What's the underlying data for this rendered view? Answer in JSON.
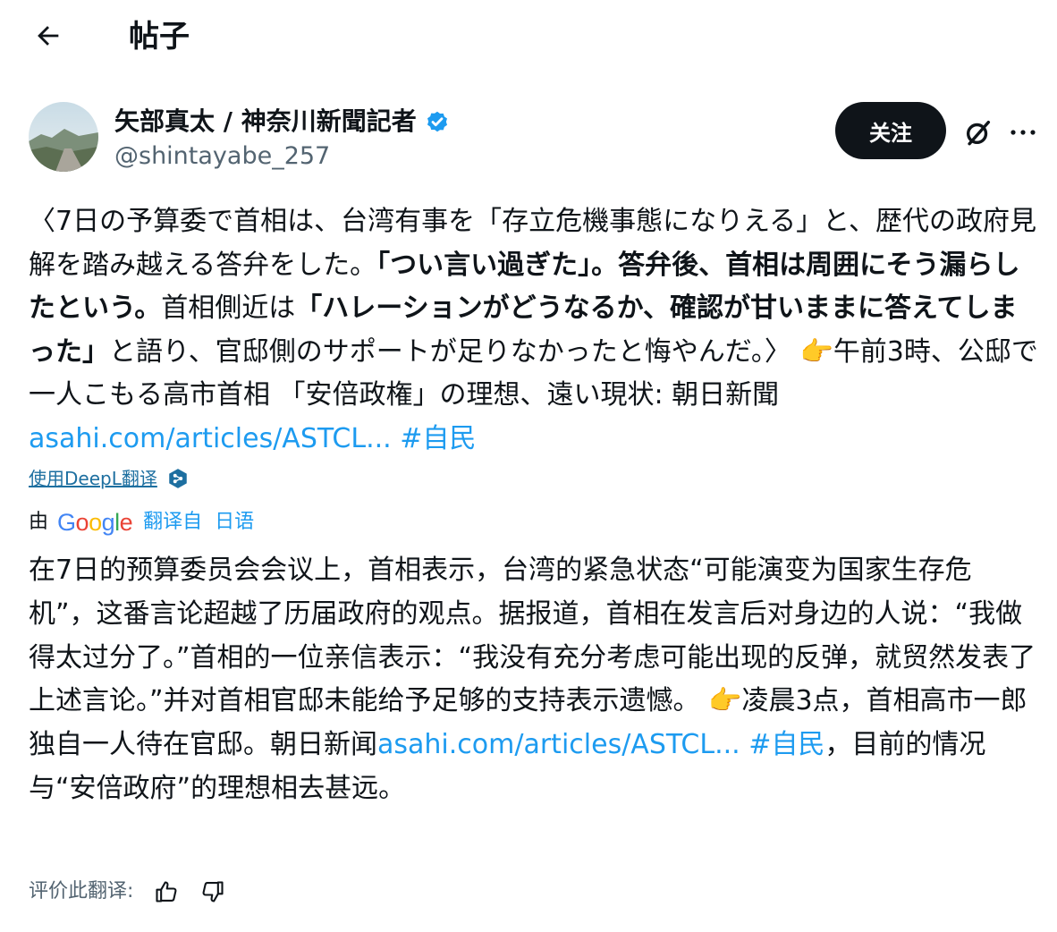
{
  "header": {
    "title": "帖子"
  },
  "author": {
    "display_name": "矢部真太 / 神奈川新聞記者",
    "handle": "@shintayabe_257",
    "follow_label": "关注"
  },
  "post": {
    "p1": "〈7日の予算委で首相は、台湾有事を「存立危機事態になりえる」と、歴代の政府見解を踏み越える答弁をした。",
    "p2_bold": "「つい言い過ぎた」。答弁後、首相は周囲にそう漏らしたという。",
    "p3": "首相側近は",
    "p4_bold": "「ハレーションがどうなるか、確認が甘いままに答えてしまった」",
    "p5": "と語り、官邸側のサポートが足りなかったと悔やんだ。〉",
    "emoji": "👉",
    "p6": "午前3時、公邸で一人こもる高市首相 「安倍政権」の理想、遠い現状: 朝日新聞",
    "link": "asahi.com/articles/ASTCL...",
    "hashtag": "#自民"
  },
  "deepl": {
    "label": "使用DeepL翻译"
  },
  "google_translate": {
    "by": "由",
    "brand": "Google",
    "translated_from": "翻译自",
    "source_language": "日语"
  },
  "translation": {
    "t1": "在7日的预算委员会会议上，首相表示，台湾的紧急状态“可能演变为国家生存危机”，这番言论超越了历届政府的观点。据报道，首相在发言后对身边的人说：“我做得太过分了。”首相的一位亲信表示：“我没有充分考虑可能出现的反弹，就贸然发表了上述言论。”并对首相官邸未能给予足够的支持表示遗憾。",
    "emoji": "👉",
    "t2": "凌晨3点，首相高市一郎独自一人待在官邸。朝日新闻",
    "link": "asahi.com/articles/ASTCL...",
    "hashtag": "#自民",
    "t3": "，目前的情况与“安倍政府”的理想相去甚远。"
  },
  "rate": {
    "label": "评价此翻译:"
  },
  "colors": {
    "link": "#1d9bf0",
    "text": "#0f1419",
    "muted": "#536471",
    "button_bg": "#0f1419"
  },
  "icons": [
    "back-arrow-icon",
    "verified-badge-icon",
    "grok-icon",
    "more-icon",
    "deepl-icon",
    "thumbs-up-icon",
    "thumbs-down-icon"
  ]
}
